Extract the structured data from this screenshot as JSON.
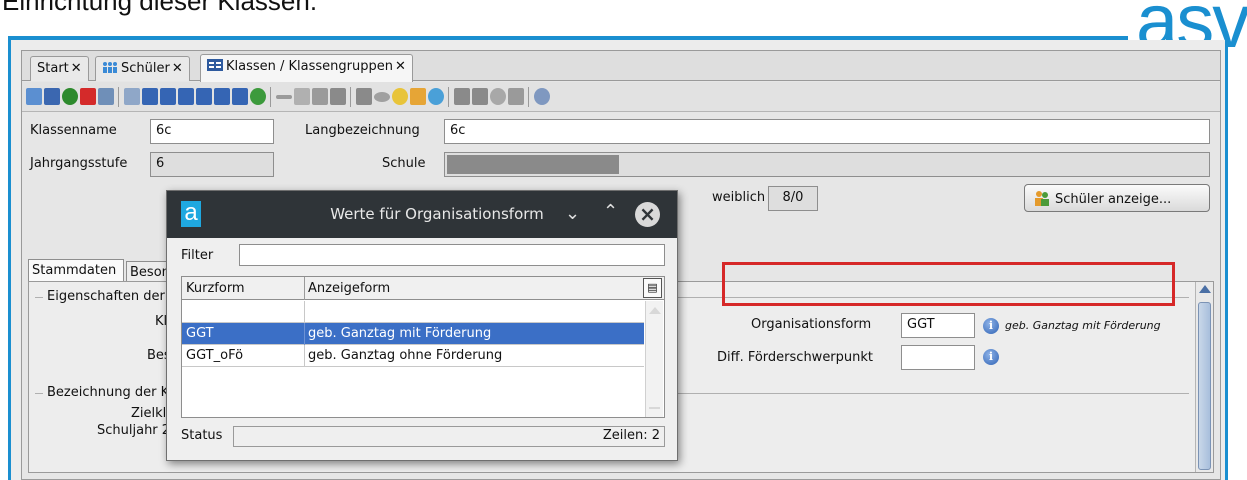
{
  "doc_title": "Einrichtung dieser Klassen.",
  "brand": "asv",
  "tabs": [
    {
      "label": "Start"
    },
    {
      "label": "Schüler"
    },
    {
      "label": "Klassen / Klassengruppen"
    }
  ],
  "tab_close": "✕",
  "toolbar_icons": [
    "new-icon",
    "save-icon",
    "undo-icon",
    "delete-icon",
    "form-icon",
    "table-icon",
    "first-icon",
    "fast-back-icon",
    "back-icon",
    "forward-icon",
    "fast-forward-icon",
    "last-icon",
    "refresh-icon",
    "arrow-left-icon",
    "cut-icon",
    "copy-icon",
    "paste-icon",
    "print-icon",
    "eye-icon",
    "bulb-icon",
    "eraser-icon",
    "clock-icon",
    "people-icon",
    "people2-icon",
    "info-disc-icon",
    "note-icon",
    "help-icon"
  ],
  "form": {
    "klassenname_label": "Klassenname",
    "klassenname_value": "6c",
    "langbezeichnung_label": "Langbezeichnung",
    "langbezeichnung_value": "6c",
    "jahrgangsstufe_label": "Jahrgangsstufe",
    "jahrgangsstufe_value": "6",
    "schule_label": "Schule",
    "weiblich_label": "weiblich",
    "weiblich_value": "8/0",
    "schueler_button": "Schüler anzeige..."
  },
  "subtabs": [
    {
      "label": "Stammdaten"
    },
    {
      "label": "Besonderheiten"
    }
  ],
  "panel": {
    "group1": "Eigenschaften der Klasse",
    "left_label_1": "Kla",
    "left_label_2": "Beso",
    "group2": "Bezeichnung der Klasse",
    "left_label_3": "Zielkla",
    "left_label_4": "Schuljahr 2",
    "organisationsform_label": "Organisationsform",
    "organisationsform_value": "GGT",
    "organisationsform_hint": "geb. Ganztag mit Förderung",
    "foerder_label": "Diff. Förderschwerpunkt",
    "foerder_value": ""
  },
  "dialog": {
    "title": "Werte für Organisationsform",
    "filter_label": "Filter",
    "filter_value": "",
    "columns": [
      "Kurzform",
      "Anzeigeform"
    ],
    "rows": [
      {
        "kurz": "",
        "anzeige": ""
      },
      {
        "kurz": "GGT",
        "anzeige": "geb. Ganztag mit Förderung"
      },
      {
        "kurz": "GGT_oFö",
        "anzeige": "geb. Ganztag ohne Förderung"
      }
    ],
    "selected_row": 1,
    "status_label": "Status",
    "status_value": "Zeilen: 2"
  }
}
